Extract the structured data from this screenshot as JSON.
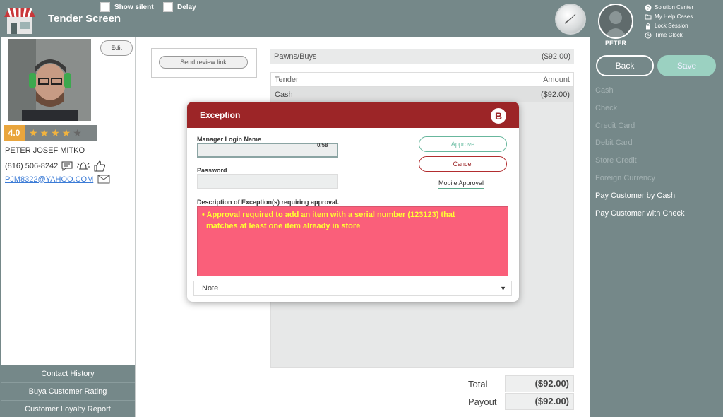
{
  "header": {
    "title": "Tender Screen",
    "show_silent_label": "Show silent",
    "delay_label": "Delay"
  },
  "customer": {
    "edit_label": "Edit",
    "rating": "4.0",
    "stars": "★★★★",
    "star_empty": "★",
    "name": "PETER JOSEF MITKO",
    "phone": "(816) 506-8242",
    "email": "PJM8322@YAHOO.COM"
  },
  "left_buttons": [
    "Contact History",
    "Buya Customer Rating",
    "Customer Loyalty Report"
  ],
  "main": {
    "send_review_label": "Send review link",
    "pawns_label": "Pawns/Buys",
    "pawns_amount": "($92.00)",
    "tender_col": "Tender",
    "amount_col": "Amount",
    "rows": [
      {
        "tender": "Cash",
        "amount": "($92.00)"
      }
    ],
    "total_label": "Total",
    "total_value": "($92.00)",
    "payout_label": "Payout",
    "payout_value": "($92.00)"
  },
  "user": {
    "name": "PETER",
    "links": [
      "Solution Center",
      "My Help Cases",
      "Lock Session",
      "Time Clock"
    ]
  },
  "actions": {
    "back_label": "Back",
    "save_label": "Save"
  },
  "payment_methods": [
    {
      "label": "Cash",
      "enabled": false
    },
    {
      "label": "Check",
      "enabled": false
    },
    {
      "label": "Credit Card",
      "enabled": false
    },
    {
      "label": "Debit Card",
      "enabled": false
    },
    {
      "label": "Store Credit",
      "enabled": false
    },
    {
      "label": "Foreign Currency",
      "enabled": false
    },
    {
      "label": "Pay Customer by Cash",
      "enabled": true
    },
    {
      "label": "Pay Customer with Check",
      "enabled": true
    }
  ],
  "modal": {
    "title": "Exception",
    "logo_letter": "B",
    "manager_login_label": "Manager Login Name",
    "manager_login_value": "",
    "counter": "0/58",
    "password_label": "Password",
    "approve_label": "Approve",
    "cancel_label": "Cancel",
    "mobile_approval_label": "Mobile Approval",
    "description_label": "Description of Exception(s) requiring approval.",
    "exception_text_line1": "• Approval required to add an item with a serial number (123123) that",
    "exception_text_line2": "matches at least one item already in store",
    "note_selected": "Note"
  },
  "colors": {
    "accent": "#9c2527",
    "panel": "#758889",
    "exception_bg": "#fa5f7a",
    "exception_text": "#ffff33",
    "approve": "#6dbfa5"
  }
}
